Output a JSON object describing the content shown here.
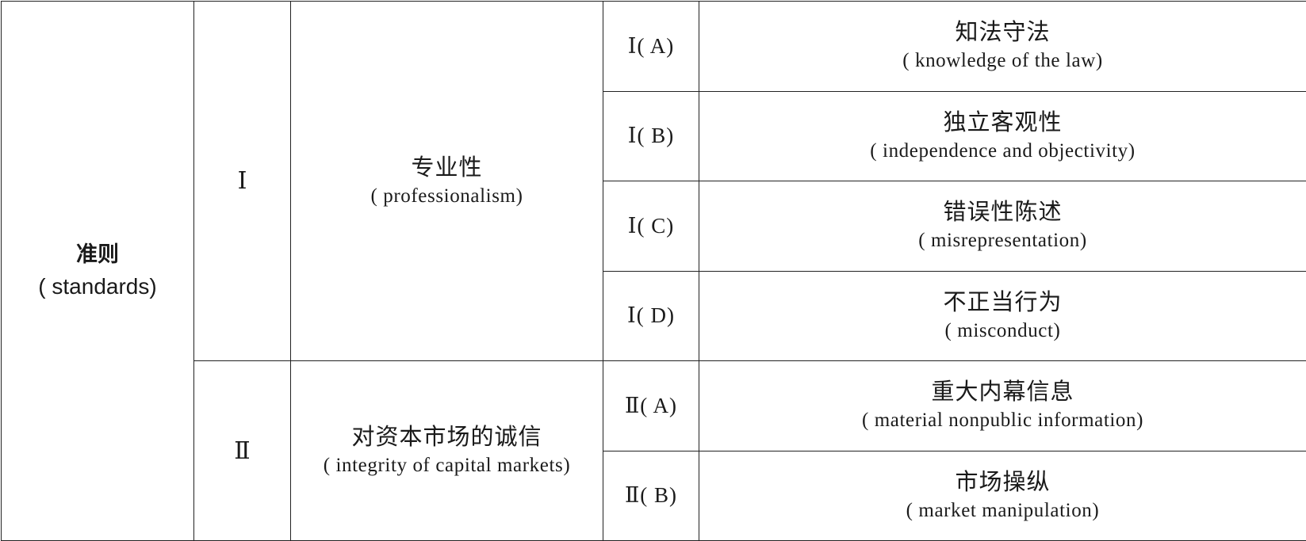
{
  "standards": {
    "label_cn": "准则",
    "label_en": "( standards)"
  },
  "groups": [
    {
      "numeral": "Ⅰ",
      "name_cn": "专业性",
      "name_en": "( professionalism)",
      "items": [
        {
          "code": "Ⅰ( A)",
          "name_cn": "知法守法",
          "name_en": "( knowledge of the law)"
        },
        {
          "code": "Ⅰ( B)",
          "name_cn": "独立客观性",
          "name_en": "( independence and objectivity)"
        },
        {
          "code": "Ⅰ( C)",
          "name_cn": "错误性陈述",
          "name_en": "( misrepresentation)"
        },
        {
          "code": "Ⅰ( D)",
          "name_cn": "不正当行为",
          "name_en": "( misconduct)"
        }
      ]
    },
    {
      "numeral": "Ⅱ",
      "name_cn": "对资本市场的诚信",
      "name_en": "( integrity of capital markets)",
      "items": [
        {
          "code": "Ⅱ( A)",
          "name_cn": "重大内幕信息",
          "name_en": "( material nonpublic information)"
        },
        {
          "code": "Ⅱ( B)",
          "name_cn": "市场操纵",
          "name_en": "( market manipulation)"
        }
      ]
    }
  ]
}
